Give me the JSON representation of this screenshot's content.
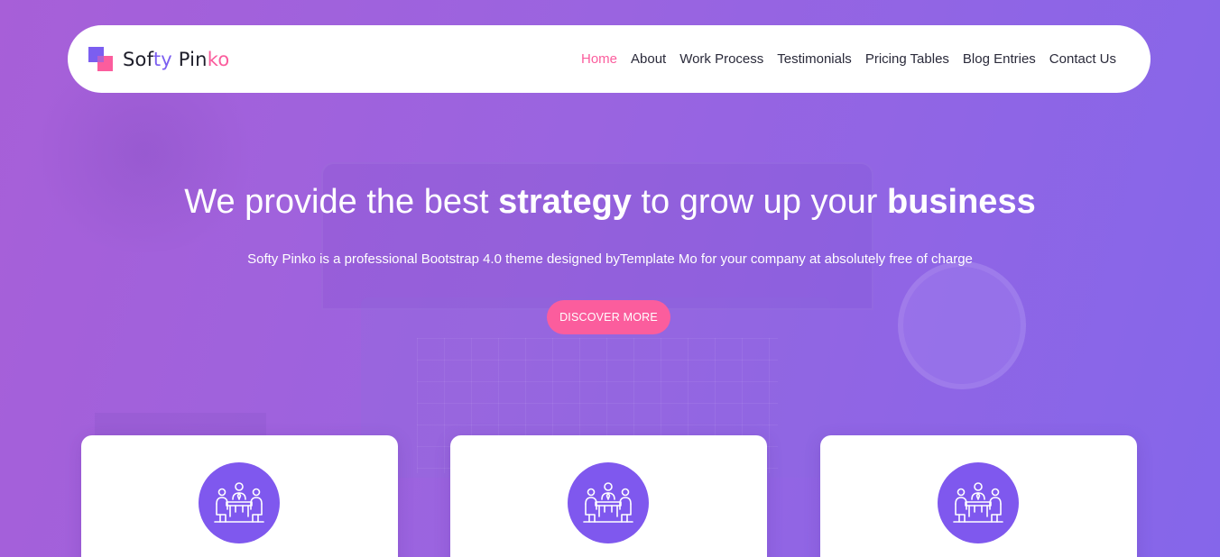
{
  "navbar": {
    "logo": {
      "parts": [
        {
          "text": "Sof",
          "tone": "dark"
        },
        {
          "text": "ty",
          "tone": "purple"
        },
        {
          "text": " Pin",
          "tone": "dark"
        },
        {
          "text": "ko",
          "tone": "pink"
        }
      ]
    },
    "menu": [
      {
        "label": "Home",
        "active": true
      },
      {
        "label": "About"
      },
      {
        "label": "Work Process"
      },
      {
        "label": "Testimonials"
      },
      {
        "label": "Pricing Tables"
      },
      {
        "label": "Blog Entries"
      },
      {
        "label": "Contact Us"
      }
    ]
  },
  "hero": {
    "title_parts": [
      {
        "text": "We provide the best ",
        "bold": false
      },
      {
        "text": "strategy",
        "bold": true
      },
      {
        "text": " to grow up your ",
        "bold": false
      },
      {
        "text": "business",
        "bold": true
      }
    ],
    "subtitle": "Softy Pinko is a professional Bootstrap 4.0 theme designed byTemplate Mo for your company at absolutely free of charge",
    "cta_label": "DISCOVER MORE"
  },
  "features": [
    {
      "icon": "team-meeting-icon"
    },
    {
      "icon": "team-meeting-icon"
    },
    {
      "icon": "team-meeting-icon"
    }
  ],
  "colors": {
    "brand_purple": "#7b5ef0",
    "brand_pink": "#fb5d9d",
    "icon_circle": "#7f58ee",
    "nav_text": "#2a2a3a",
    "background_start": "#a75fd8",
    "background_end": "#8566ea"
  }
}
